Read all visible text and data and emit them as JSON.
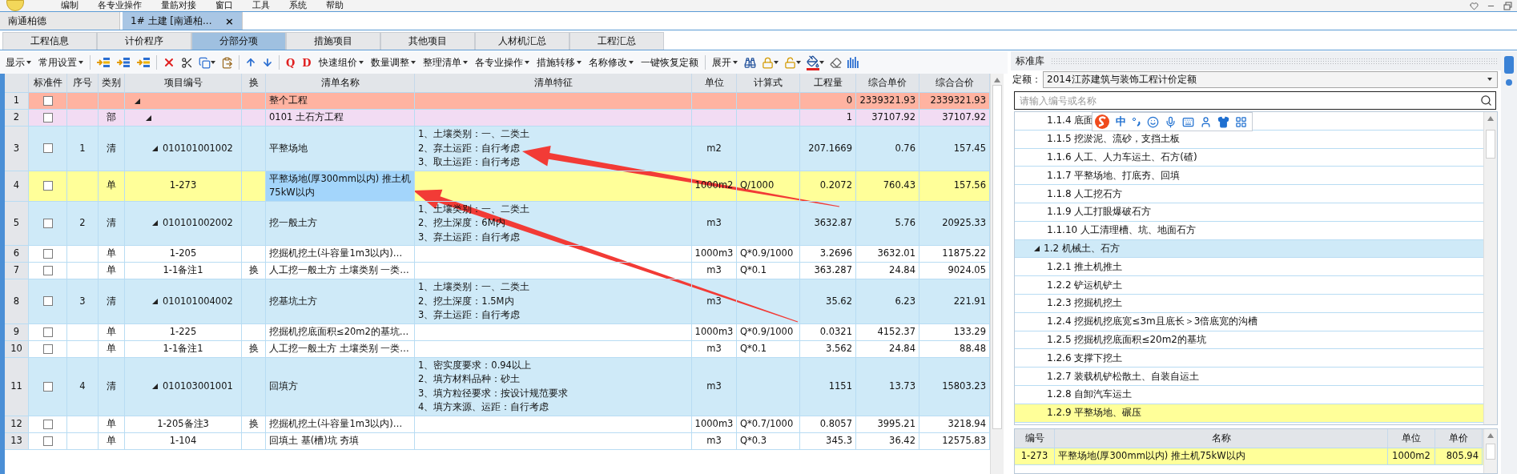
{
  "menu": [
    "编制",
    "各专业操作",
    "量筋对接",
    "窗口",
    "工具",
    "系统",
    "帮助"
  ],
  "doc_tabs": [
    {
      "label": "南通柏德",
      "selected": false
    },
    {
      "label": "1# 土建 [南通柏...",
      "selected": true,
      "close": "×"
    }
  ],
  "module_tabs": [
    {
      "label": "工程信息",
      "selected": false
    },
    {
      "label": "计价程序",
      "selected": false
    },
    {
      "label": "分部分项",
      "selected": true
    },
    {
      "label": "措施项目",
      "selected": false
    },
    {
      "label": "其他项目",
      "selected": false
    },
    {
      "label": "人材机汇总",
      "selected": false
    },
    {
      "label": "工程汇总",
      "selected": false
    }
  ],
  "toolbar": {
    "left": [
      {
        "label": "显示",
        "dropdown": true
      },
      {
        "label": "常用设置",
        "dropdown": true
      }
    ],
    "letter_icons": [
      "Q",
      "D"
    ],
    "middle": [
      {
        "label": "快速组价",
        "dropdown": true
      },
      {
        "label": "数量调整",
        "dropdown": true
      },
      {
        "label": "整理清单",
        "dropdown": true
      },
      {
        "label": "各专业操作",
        "dropdown": true
      },
      {
        "label": "措施转移",
        "dropdown": true
      },
      {
        "label": "名称修改",
        "dropdown": true
      },
      {
        "label": "一键恢复定额",
        "dropdown": false
      }
    ],
    "right": [
      {
        "label": "展开",
        "dropdown": true
      }
    ]
  },
  "table": {
    "columns": [
      "标准件",
      "序号",
      "类别",
      "项目编号",
      "换",
      "清单名称",
      "清单特征",
      "单位",
      "计算式",
      "工程量",
      "综合单价",
      "综合合价"
    ],
    "rows": [
      {
        "num": "1",
        "kind": "project",
        "selected": false,
        "checked": false,
        "expanded": true,
        "name": "整个工程",
        "qty": "0",
        "price": "2339321.93",
        "total": "2339321.93"
      },
      {
        "num": "2",
        "kind": "division",
        "selected": false,
        "checked": false,
        "expanded": true,
        "type": "部",
        "name": "0101 土石方工程",
        "qty": "1",
        "price": "37107.92",
        "total": "37107.92"
      },
      {
        "num": "3",
        "kind": "item",
        "selected": false,
        "checked": false,
        "expanded": true,
        "seq": "1",
        "type": "清",
        "code": "010101001002",
        "name": "平整场地",
        "features": "1、土壤类别：一、二类土\n2、弃土运距：自行考虑\n3、取土运距：自行考虑",
        "unit": "m2",
        "qty": "207.1669",
        "price": "0.76",
        "total": "157.45"
      },
      {
        "num": "4",
        "kind": "quota",
        "selected": true,
        "checked": false,
        "type": "单",
        "code": "1-273",
        "name": "平整场地(厚300mm以内) 推土机75kW以内",
        "unit": "1000m2",
        "formula": "Q/1000",
        "qty": "0.2072",
        "price": "760.43",
        "total": "157.56"
      },
      {
        "num": "5",
        "kind": "item",
        "selected": false,
        "checked": false,
        "expanded": true,
        "seq": "2",
        "type": "清",
        "code": "010101002002",
        "name": "挖一般土方",
        "features": "1、土壤类别：一、二类土\n2、挖土深度：6M内\n3、弃土运距：自行考虑",
        "unit": "m3",
        "qty": "3632.87",
        "price": "5.76",
        "total": "20925.33"
      },
      {
        "num": "6",
        "kind": "quota",
        "selected": false,
        "checked": false,
        "type": "单",
        "code": "1-205",
        "name": "挖掘机挖土(斗容量1m3以内)…",
        "unit": "1000m3",
        "formula": "Q*0.9/1000",
        "qty": "3.2696",
        "price": "3632.01",
        "total": "11875.22"
      },
      {
        "num": "7",
        "kind": "quota",
        "selected": false,
        "checked": false,
        "type": "单",
        "code": "1-1备注1",
        "swap": "换",
        "name": "人工挖一般土方 土壤类别 一类…",
        "unit": "m3",
        "formula": "Q*0.1",
        "qty": "363.287",
        "price": "24.84",
        "total": "9024.05"
      },
      {
        "num": "8",
        "kind": "item",
        "selected": false,
        "checked": false,
        "expanded": true,
        "seq": "3",
        "type": "清",
        "code": "010101004002",
        "name": "挖基坑土方",
        "features": "1、土壤类别：一、二类土\n2、挖土深度：1.5M内\n3、弃土运距：自行考虑",
        "unit": "m3",
        "qty": "35.62",
        "price": "6.23",
        "total": "221.91"
      },
      {
        "num": "9",
        "kind": "quota",
        "selected": false,
        "checked": false,
        "type": "单",
        "code": "1-225",
        "name": "挖掘机挖底面积≤20m2的基坑…",
        "unit": "1000m3",
        "formula": "Q*0.9/1000",
        "qty": "0.0321",
        "price": "4152.37",
        "total": "133.29"
      },
      {
        "num": "10",
        "kind": "quota",
        "selected": false,
        "checked": false,
        "type": "单",
        "code": "1-1备注1",
        "swap": "换",
        "name": "人工挖一般土方 土壤类别 一类…",
        "unit": "m3",
        "formula": "Q*0.1",
        "qty": "3.562",
        "price": "24.84",
        "total": "88.48"
      },
      {
        "num": "11",
        "kind": "item",
        "selected": false,
        "checked": false,
        "expanded": true,
        "seq": "4",
        "type": "清",
        "code": "010103001001",
        "name": "回填方",
        "features": "1、密实度要求：0.94以上\n2、填方材料品种：砂土\n3、填方粒径要求：按设计规范要求\n4、填方来源、运距：自行考虑",
        "unit": "m3",
        "qty": "1151",
        "price": "13.73",
        "total": "15803.23"
      },
      {
        "num": "12",
        "kind": "quota",
        "selected": false,
        "checked": false,
        "type": "单",
        "code": "1-205备注3",
        "swap": "换",
        "name": "挖掘机挖土(斗容量1m3以内)…",
        "unit": "1000m3",
        "formula": "Q*0.7/1000",
        "qty": "0.8057",
        "price": "3995.21",
        "total": "3218.94"
      },
      {
        "num": "13",
        "kind": "quota",
        "selected": false,
        "checked": false,
        "type": "单",
        "code": "1-104",
        "name": "回填土 基(槽)坑 夯填",
        "unit": "m3",
        "formula": "Q*0.3",
        "qty": "345.3",
        "price": "36.42",
        "total": "12575.83"
      }
    ]
  },
  "library": {
    "title": "标准库",
    "quota_label": "定额：",
    "quota_value": "2014江苏建筑与装饰工程计价定额",
    "search": {
      "placeholder": "请输入编号或名称"
    },
    "ime": {
      "mode": "中"
    },
    "tree": [
      {
        "label": "1.1.4 底面",
        "selected": false
      },
      {
        "label": "1.1.5 挖淤泥、流砂，支挡土板",
        "selected": false
      },
      {
        "label": "1.1.6 人工、人力车运土、石方(碴)",
        "selected": false
      },
      {
        "label": "1.1.7 平整场地、打底夯、回填",
        "selected": false
      },
      {
        "label": "1.1.8 人工挖石方",
        "selected": false
      },
      {
        "label": "1.1.9 人工打眼爆破石方",
        "selected": false
      },
      {
        "label": "1.1.10 人工清理槽、坑、地面石方",
        "selected": false
      },
      {
        "label": "1.2 机械土、石方",
        "selected": false,
        "expanded": true,
        "children": [
          {
            "label": "1.2.1 推土机推土",
            "selected": false
          },
          {
            "label": "1.2.2 铲运机铲土",
            "selected": false
          },
          {
            "label": "1.2.3 挖掘机挖土",
            "selected": false
          },
          {
            "label": "1.2.4 挖掘机挖底宽≤3m且底长＞3倍底宽的沟槽",
            "selected": false
          },
          {
            "label": "1.2.5 挖掘机挖底面积≤20m2的基坑",
            "selected": false
          },
          {
            "label": "1.2.6 支撑下挖土",
            "selected": false
          },
          {
            "label": "1.2.7 装载机铲松散土、自装自运土",
            "selected": false
          },
          {
            "label": "1.2.8 自卸汽车运土",
            "selected": false
          },
          {
            "label": "1.2.9 平整场地、碾压",
            "selected": true
          }
        ]
      }
    ],
    "items": {
      "columns": [
        "编号",
        "名称",
        "单位",
        "单价"
      ],
      "rows": [
        {
          "code": "1-273",
          "name": "平整场地(厚300mm以内) 推土机75kW以内",
          "unit": "1000m2",
          "price": "805.94",
          "selected": true
        }
      ]
    }
  }
}
